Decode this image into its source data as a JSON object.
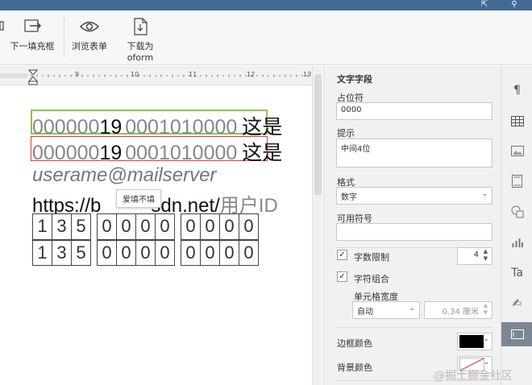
{
  "topbar": {
    "icons": [
      "open-location-icon",
      "search-icon"
    ]
  },
  "toolbar": {
    "next_field_label": "下一填充框",
    "view_form_label": "浏览表单",
    "download_label": "下载为oform"
  },
  "ruler": {
    "numbers": [
      "9",
      "10",
      "11",
      "12",
      "13"
    ]
  },
  "document": {
    "line1": {
      "digits_a": "000000",
      "digits_b": "19",
      "digits_c": "0001010000",
      "suffix": "这是"
    },
    "line2": {
      "digits_a": "000000",
      "digits_b": "19",
      "digits_c": "0001010000",
      "suffix": "这是"
    },
    "email_placeholder": "userame@mailserver",
    "url_start": "https://b",
    "url_end": "sdn.net/",
    "user_id_placeholder": "用户ID",
    "tooltip": "爱填不填",
    "grid_row1": [
      "1",
      "3",
      "5",
      "0",
      "0",
      "0",
      "0",
      "0",
      "0",
      "0",
      "0"
    ],
    "grid_row2": [
      "1",
      "3",
      "5",
      "0",
      "0",
      "0",
      "0",
      "0",
      "0",
      "0",
      "0"
    ]
  },
  "panel": {
    "title": "文字字段",
    "placeholder_label": "占位符",
    "placeholder_value": "0000",
    "tip_label": "提示",
    "tip_value": "中间4位",
    "format_label": "格式",
    "format_value": "数字",
    "allowed_symbols_label": "可用符号",
    "allowed_symbols_value": "",
    "char_limit_label": "字数限制",
    "char_limit_value": "4",
    "char_limit_checked": true,
    "comb_label": "字符组合",
    "comb_checked": true,
    "cell_width_label": "单元格宽度",
    "cell_width_mode": "自动",
    "cell_width_value": "0.34 厘米",
    "border_color_label": "边框颜色",
    "border_color": "#000000",
    "bg_color_label": "背景颜色"
  },
  "iconbar": {
    "icons": [
      "paragraph-icon",
      "table-icon",
      "image-icon",
      "header-footer-icon",
      "shape-icon",
      "chart-icon",
      "text-art-icon",
      "signature-icon",
      "form-field-icon"
    ],
    "active_index": 8
  },
  "watermark": "@掘土掘金社区"
}
